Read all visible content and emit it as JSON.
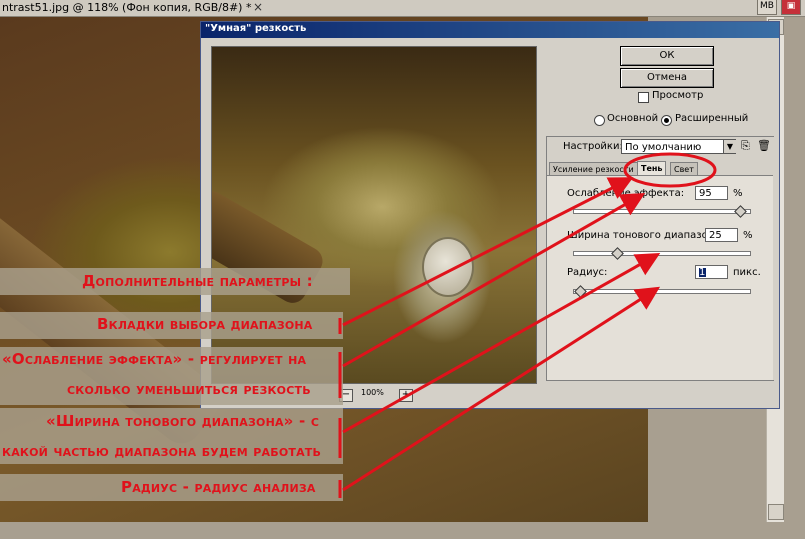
{
  "document": {
    "title": "ntrast51.jpg @ 118% (Фон копия, RGB/8#) *",
    "tab_close": "×"
  },
  "window_buttons": [
    "MB",
    "▣"
  ],
  "dialog": {
    "title": "\"Умная\" резкость",
    "ok_label": "ОК",
    "cancel_label": "Отмена",
    "preview_label": "Просмотр",
    "preview_checked": false,
    "mode_basic_label": "Основной",
    "mode_advanced_label": "Расширенный",
    "mode_selected": "advanced",
    "zoom_minus": "−",
    "zoom_value": "100%",
    "zoom_plus": "+",
    "settings_label": "Настройки:",
    "preset_value": "По умолчанию",
    "tabs": [
      {
        "label": "Усиление резкости",
        "active": false
      },
      {
        "label": "Тень",
        "active": true
      },
      {
        "label": "Свет",
        "active": false
      }
    ],
    "fade_label": "Ослабление эффекта:",
    "fade_value": "95",
    "fade_unit": "%",
    "fade_slider": 0.95,
    "tonal_width_label": "Ширина тонового диапазона:",
    "tonal_width_value": "25",
    "tonal_width_unit": "%",
    "tonal_width_slider": 0.25,
    "radius_label": "Радиус:",
    "radius_value": "1",
    "radius_unit": "пикс.",
    "radius_slider": 0.04
  },
  "annotations": {
    "extra_params": "Дополнительные параметры :",
    "range_tabs": "Вкладки выбора диапазона",
    "fade_line1": "«Ослабление эффекта» - регулирует на",
    "fade_line2": "сколько уменьшиться резкость",
    "width_line1": "«Ширина тонового диапазона» - с",
    "width_line2": "какой частью диапазона будем работать",
    "radius": "Радиус - радиус анализа",
    "accent_color": "#e0121b"
  }
}
